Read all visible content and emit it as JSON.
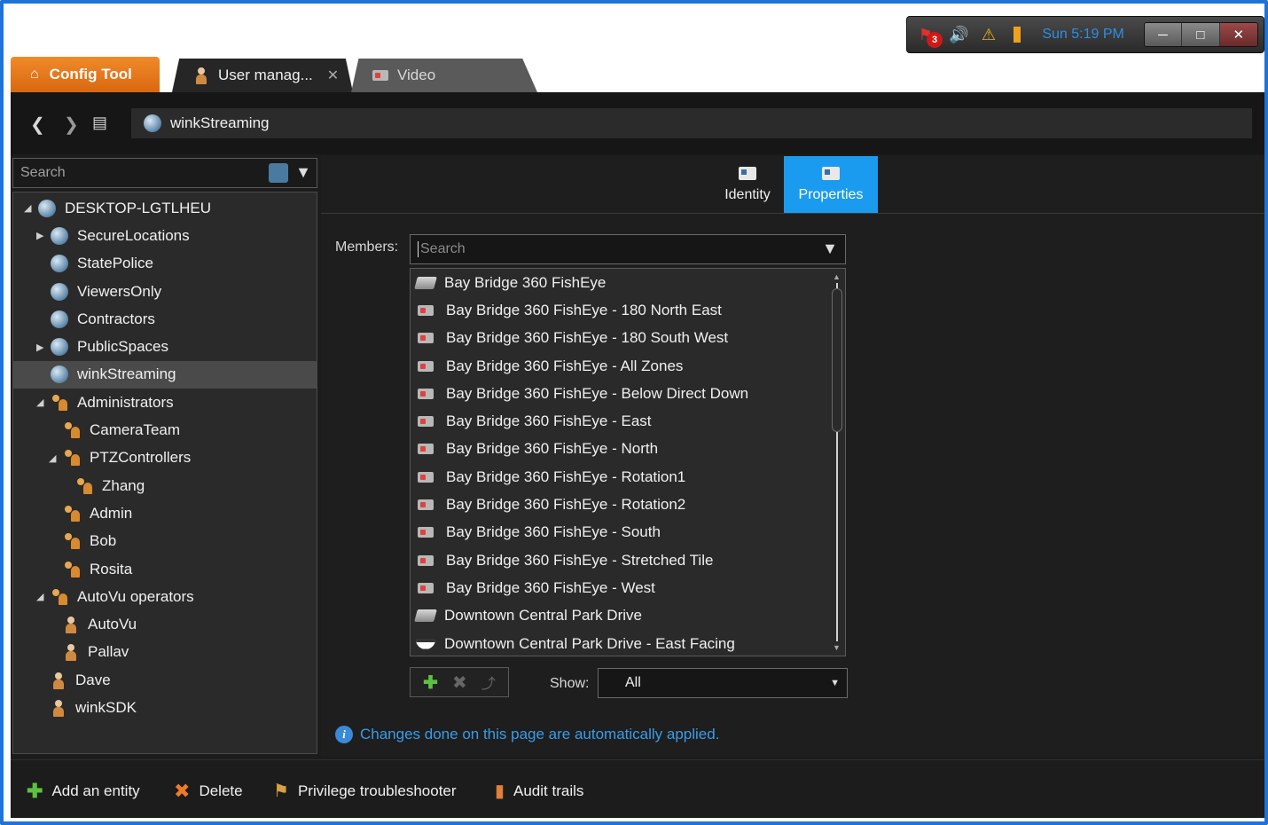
{
  "tray": {
    "alert_count": "3",
    "time": "Sun 5:19 PM"
  },
  "tabs": {
    "home": "Config Tool",
    "user": "User manag...",
    "video": "Video"
  },
  "nav": {
    "breadcrumb": "winkStreaming"
  },
  "left": {
    "search_placeholder": "Search",
    "tree": [
      {
        "label": "DESKTOP-LGTLHEU",
        "icon": "globe",
        "level": 0,
        "arrow": "expanded"
      },
      {
        "label": "SecureLocations",
        "icon": "globe",
        "level": 1,
        "arrow": "collapsed"
      },
      {
        "label": "StatePolice",
        "icon": "globe",
        "level": 1,
        "arrow": ""
      },
      {
        "label": "ViewersOnly",
        "icon": "globe",
        "level": 1,
        "arrow": ""
      },
      {
        "label": "Contractors",
        "icon": "globe",
        "level": 1,
        "arrow": ""
      },
      {
        "label": "PublicSpaces",
        "icon": "globe",
        "level": 1,
        "arrow": "collapsed"
      },
      {
        "label": "winkStreaming",
        "icon": "globe",
        "level": 1,
        "arrow": "",
        "selected": true
      },
      {
        "label": "Administrators",
        "icon": "group",
        "level": 1,
        "arrow": "expanded"
      },
      {
        "label": "CameraTeam",
        "icon": "group",
        "level": 2,
        "arrow": ""
      },
      {
        "label": "PTZControllers",
        "icon": "group",
        "level": 2,
        "arrow": "expanded"
      },
      {
        "label": "Zhang",
        "icon": "group",
        "level": 3,
        "arrow": ""
      },
      {
        "label": "Admin",
        "icon": "group",
        "level": 2,
        "arrow": ""
      },
      {
        "label": "Bob",
        "icon": "group",
        "level": 2,
        "arrow": ""
      },
      {
        "label": "Rosita",
        "icon": "group",
        "level": 2,
        "arrow": ""
      },
      {
        "label": "AutoVu operators",
        "icon": "group",
        "level": 1,
        "arrow": "expanded"
      },
      {
        "label": "AutoVu",
        "icon": "user",
        "level": 2,
        "arrow": ""
      },
      {
        "label": "Pallav",
        "icon": "user",
        "level": 2,
        "arrow": ""
      },
      {
        "label": "Dave",
        "icon": "user",
        "level": 1,
        "arrow": ""
      },
      {
        "label": "winkSDK",
        "icon": "user",
        "level": 1,
        "arrow": ""
      }
    ]
  },
  "right": {
    "tab_identity": "Identity",
    "tab_properties": "Properties",
    "members_label": "Members:",
    "members_search_placeholder": "Search",
    "members": [
      {
        "label": "Bay Bridge 360 FishEye",
        "icon": "fisheye"
      },
      {
        "label": "Bay Bridge 360 FishEye - 180 North East",
        "icon": "camera"
      },
      {
        "label": "Bay Bridge 360 FishEye - 180 South West",
        "icon": "camera"
      },
      {
        "label": "Bay Bridge 360 FishEye - All Zones",
        "icon": "camera"
      },
      {
        "label": "Bay Bridge 360 FishEye - Below Direct Down",
        "icon": "camera"
      },
      {
        "label": "Bay Bridge 360 FishEye - East",
        "icon": "camera"
      },
      {
        "label": "Bay Bridge 360 FishEye - North",
        "icon": "camera"
      },
      {
        "label": "Bay Bridge 360 FishEye - Rotation1",
        "icon": "camera"
      },
      {
        "label": "Bay Bridge 360 FishEye - Rotation2",
        "icon": "camera"
      },
      {
        "label": "Bay Bridge 360 FishEye - South",
        "icon": "camera"
      },
      {
        "label": "Bay Bridge 360 FishEye - Stretched Tile",
        "icon": "camera"
      },
      {
        "label": "Bay Bridge 360 FishEye - West",
        "icon": "camera"
      },
      {
        "label": "Downtown Central Park Drive",
        "icon": "fisheye"
      },
      {
        "label": "Downtown Central Park Drive - East Facing",
        "icon": "dome"
      }
    ],
    "show_label": "Show:",
    "show_value": "All",
    "info_text": "Changes done on this page are automatically applied."
  },
  "bottom": {
    "add": "Add an entity",
    "delete": "Delete",
    "privilege": "Privilege troubleshooter",
    "audit": "Audit trails"
  },
  "colors": {
    "accent": "#1a9bef",
    "home_tab": "#e8781a",
    "info": "#3a9ce8"
  }
}
